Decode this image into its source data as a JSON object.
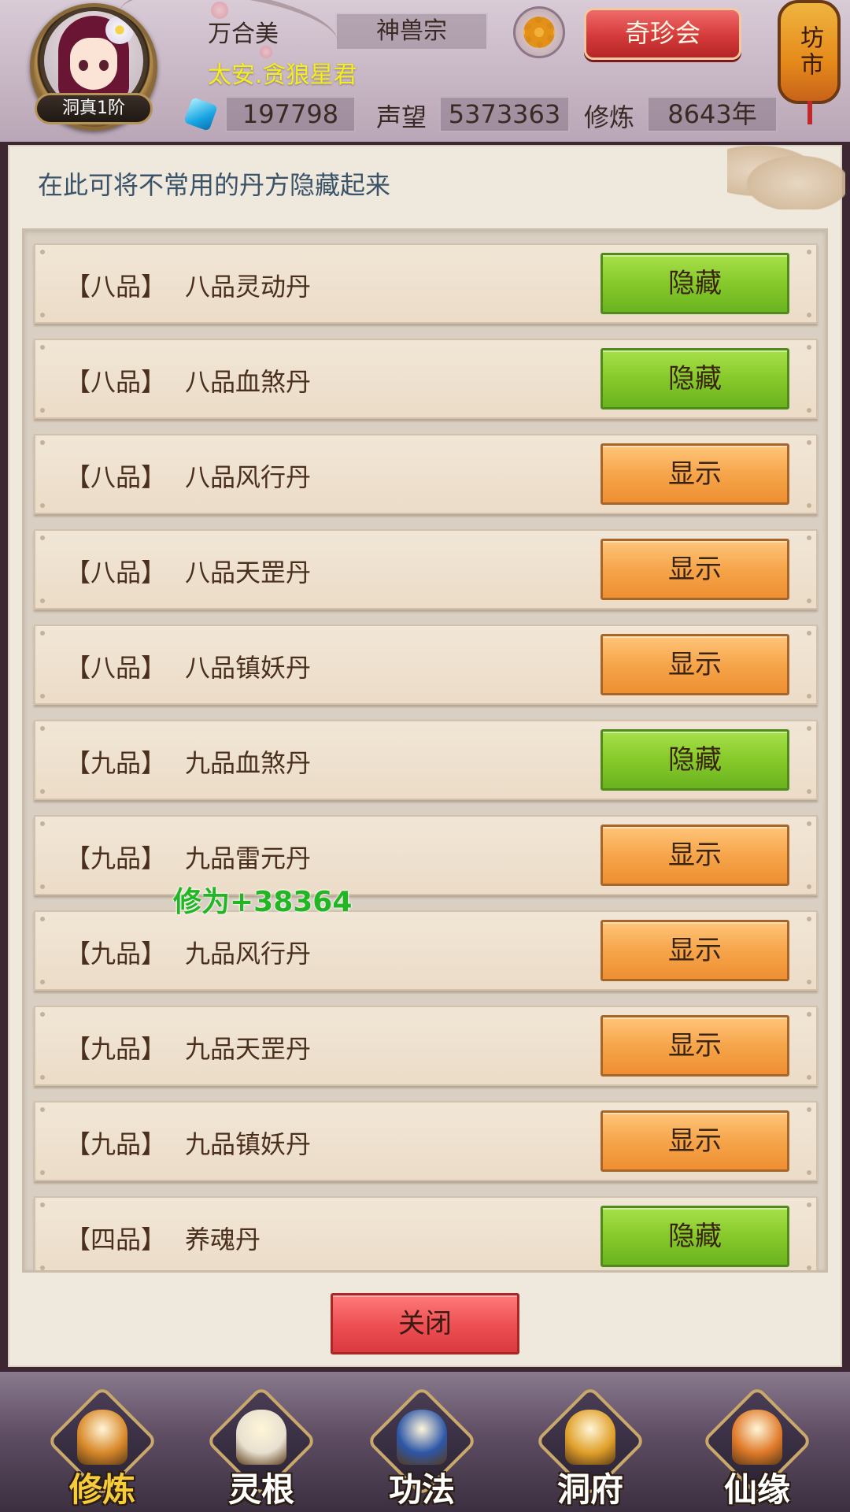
{
  "header": {
    "player_name": "万合美",
    "player_title": "太安.贪狼星君",
    "rank": "洞真1阶",
    "sect": "神兽宗",
    "treasure_button": "奇珍会",
    "market_label": "坊市",
    "stats": {
      "spirit_stones": "197798",
      "reputation_label": "声望",
      "reputation": "5373363",
      "cultivation_label": "修炼",
      "cultivation": "8643年"
    }
  },
  "panel": {
    "hint": "在此可将不常用的丹方隐藏起来",
    "close_button": "关闭",
    "gain_popup": "修为+38364",
    "recipes": [
      {
        "grade": "【八品】",
        "name": "八品灵动丹",
        "action": "隐藏",
        "state": "hide"
      },
      {
        "grade": "【八品】",
        "name": "八品血煞丹",
        "action": "隐藏",
        "state": "hide"
      },
      {
        "grade": "【八品】",
        "name": "八品风行丹",
        "action": "显示",
        "state": "show"
      },
      {
        "grade": "【八品】",
        "name": "八品天罡丹",
        "action": "显示",
        "state": "show"
      },
      {
        "grade": "【八品】",
        "name": "八品镇妖丹",
        "action": "显示",
        "state": "show"
      },
      {
        "grade": "【九品】",
        "name": "九品血煞丹",
        "action": "隐藏",
        "state": "hide"
      },
      {
        "grade": "【九品】",
        "name": "九品雷元丹",
        "action": "显示",
        "state": "show"
      },
      {
        "grade": "【九品】",
        "name": "九品风行丹",
        "action": "显示",
        "state": "show"
      },
      {
        "grade": "【九品】",
        "name": "九品天罡丹",
        "action": "显示",
        "state": "show"
      },
      {
        "grade": "【九品】",
        "name": "九品镇妖丹",
        "action": "显示",
        "state": "show"
      },
      {
        "grade": "【四品】",
        "name": "养魂丹",
        "action": "隐藏",
        "state": "hide"
      }
    ]
  },
  "bottom_nav": {
    "items": [
      {
        "label": "修炼",
        "icon": "cultivator-icon",
        "active": true
      },
      {
        "label": "灵根",
        "icon": "yin-yang-sword-icon",
        "active": false
      },
      {
        "label": "功法",
        "icon": "scripture-book-icon",
        "active": false
      },
      {
        "label": "洞府",
        "icon": "pavilion-icon",
        "active": false
      },
      {
        "label": "仙缘",
        "icon": "gourd-icon",
        "active": false
      }
    ]
  },
  "colors": {
    "hide_button": "#86c92a",
    "show_button": "#f6a54a",
    "close_button": "#ec4e52",
    "title_yellow": "#f5ee1a",
    "gain_green": "#22b624",
    "nav_active": "#f7cc3a"
  }
}
